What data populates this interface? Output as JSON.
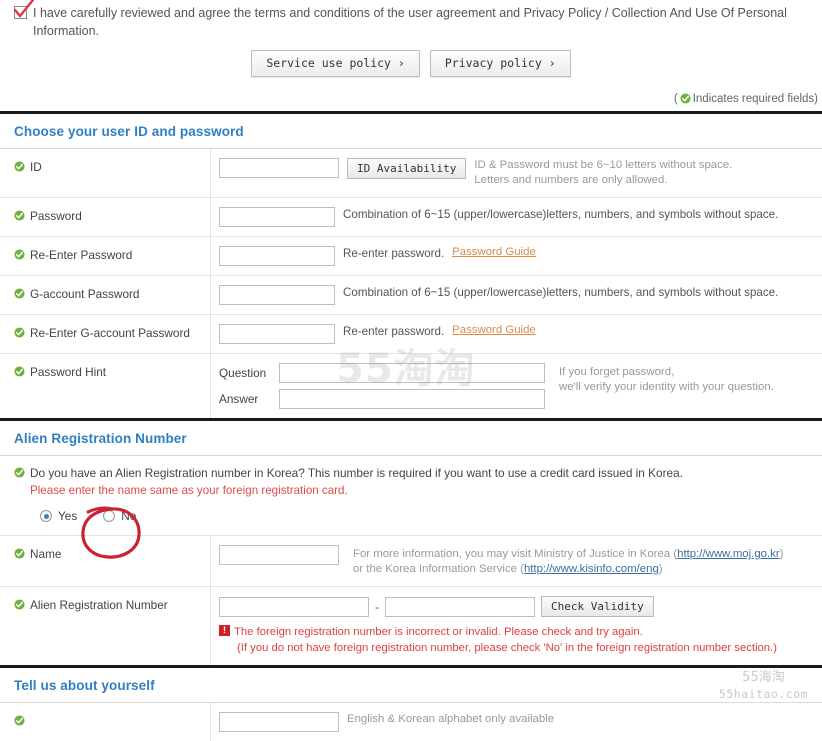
{
  "agreement": {
    "checkbox_checked": true,
    "text": "I have carefully reviewed and agree the terms and conditions of the user agreement and Privacy Policy / Collection And Use Of Personal Information.",
    "buttons": [
      {
        "label": "Service use policy ›"
      },
      {
        "label": "Privacy policy ›"
      }
    ]
  },
  "required_note": {
    "open_paren": "(",
    "text": "Indicates required fields)"
  },
  "sections": {
    "credentials": {
      "title": "Choose your user ID and password",
      "rows": {
        "id": {
          "label": "ID",
          "value": "",
          "button": "ID Availability",
          "hint_line1": "ID & Password must be 6~10 letters without space.",
          "hint_line2": "Letters and numbers are only allowed."
        },
        "password": {
          "label": "Password",
          "value": "",
          "hint": "Combination of 6~15 (upper/lowercase)letters, numbers, and symbols without space."
        },
        "re_password": {
          "label": "Re-Enter Password",
          "value": "",
          "hint": "Re-enter password.",
          "guide_link": "Password Guide"
        },
        "g_password": {
          "label": "G-account Password",
          "value": "",
          "hint": "Combination of 6~15 (upper/lowercase)letters, numbers, and symbols without space."
        },
        "re_g_password": {
          "label": "Re-Enter G-account Password",
          "value": "",
          "hint": "Re-enter password.",
          "guide_link": "Password Guide"
        },
        "password_hint": {
          "label": "Password Hint",
          "question_label": "Question",
          "question_value": "",
          "answer_label": "Answer",
          "answer_value": "",
          "hint_line1": "If you forget password,",
          "hint_line2": "we'll verify your identity with your question."
        }
      }
    },
    "alien": {
      "title": "Alien Registration Number",
      "question": "Do you have an Alien Registration number in Korea? This number is required if you want to use a credit card issued in Korea.",
      "warning": "Please enter the name same as your foreign registration card.",
      "radio_yes": {
        "label": "Yes",
        "selected": true
      },
      "radio_no": {
        "label": "No",
        "selected": false
      },
      "annotation": "red-hand-drawn-circle-around-no",
      "name_row": {
        "label": "Name",
        "value": "",
        "info_line1_a": "For more information, you may visit Ministry of Justice in Korea (",
        "info_link1": "http://www.moj.go.kr",
        "info_line1_b": ")",
        "info_line2_a": "or the Korea Information Service (",
        "info_link2": "http://www.kisinfo.com/eng",
        "info_line2_b": ")"
      },
      "number_row": {
        "label": "Alien Registration Number",
        "value_first": "",
        "separator": "-",
        "value_second": "",
        "button": "Check Validity",
        "error_icon": "!",
        "error_line1": "The foreign registration number is incorrect or invalid. Please check and try again.",
        "error_line2": "(If you do not have foreign registration number, please check 'No' in the foreign registration number section.)"
      }
    },
    "about_you": {
      "title": "Tell us about yourself",
      "first_row": {
        "value": "",
        "hint": "English & Korean alphabet only available"
      }
    }
  },
  "watermarks": {
    "center": "55淘淘",
    "corner_line1": "55海淘",
    "corner_line2": "55haitao.com"
  },
  "colors": {
    "section_title": "#2f7fc1",
    "required_green": "#6cb33f",
    "warn_red": "#e14b4b",
    "error_red": "#e0403f",
    "link_blue": "#3b6ea8",
    "guide_orange": "#d98b4a",
    "annotation_red": "#cc2233"
  }
}
